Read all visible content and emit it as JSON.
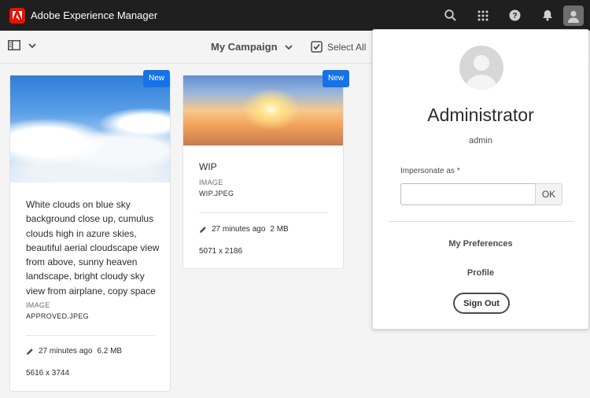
{
  "header": {
    "app_title": "Adobe Experience Manager",
    "icons": [
      "search-icon",
      "apps-icon",
      "help-icon",
      "bell-icon",
      "user-icon"
    ]
  },
  "actionbar": {
    "collection_title": "My Campaign",
    "select_all_label": "Select All"
  },
  "cards": [
    {
      "badge": "New",
      "title": "White clouds on blue sky background close up, cumulus clouds high in azure skies, beautiful aerial cloudscape view from above, sunny heaven landscape, bright cloudy sky view from airplane, copy space",
      "type": "IMAGE",
      "filename": "APPROVED.JPEG",
      "modified": "27 minutes ago",
      "size": "6.2 MB",
      "dimensions": "5616 x 3744"
    },
    {
      "badge": "New",
      "title": "WIP",
      "type": "IMAGE",
      "filename": "WIP.JPEG",
      "modified": "27 minutes ago",
      "size": "2 MB",
      "dimensions": "5071 x 2186"
    }
  ],
  "profile": {
    "name": "Administrator",
    "username": "admin",
    "impersonate_label": "Impersonate as *",
    "impersonate_value": "",
    "ok_label": "OK",
    "preferences_label": "My Preferences",
    "profile_label": "Profile",
    "sign_out_label": "Sign Out"
  },
  "colors": {
    "topbar": "#1f1f1f",
    "brand_red": "#eb1000",
    "badge_blue": "#1473e6"
  }
}
